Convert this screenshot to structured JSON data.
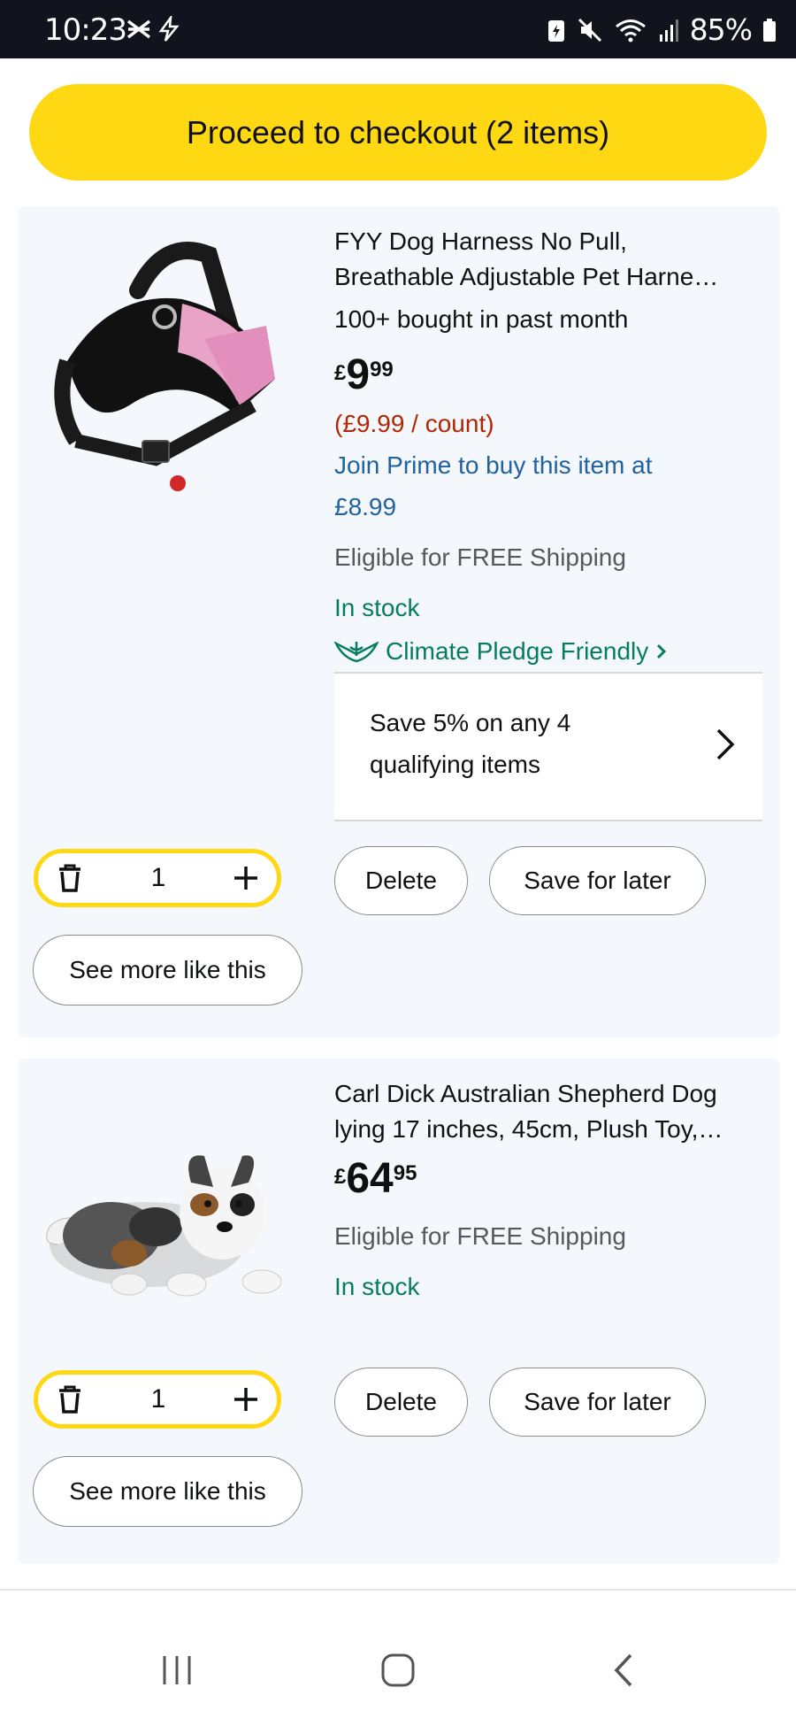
{
  "status_bar": {
    "time": "10:23",
    "battery": "85%"
  },
  "checkout": {
    "label": "Proceed to checkout (2 items)"
  },
  "items": [
    {
      "title_line1": "FYY Dog Harness No Pull,",
      "title_line2": "Breathable Adjustable Pet Harne…",
      "bought": "100+ bought in past month",
      "price_currency": "£",
      "price_whole": "9",
      "price_fraction": "99",
      "unit_price": "(£9.99 / count)",
      "prime_line1": "Join Prime to buy this item at",
      "prime_line2": "£8.99",
      "shipping": "Eligible for FREE Shipping",
      "stock": "In stock",
      "climate": "Climate Pledge Friendly",
      "promo_line1": "Save 5% on any 4",
      "promo_line2": "qualifying items",
      "quantity": "1",
      "delete_label": "Delete",
      "save_label": "Save for later",
      "more_label": "See more like this"
    },
    {
      "title_line1": "Carl Dick Australian Shepherd Dog",
      "title_line2": "lying 17 inches, 45cm, Plush Toy,…",
      "price_currency": "£",
      "price_whole": "64",
      "price_fraction": "95",
      "shipping": "Eligible for FREE Shipping",
      "stock": "In stock",
      "quantity": "1",
      "delete_label": "Delete",
      "save_label": "Save for later",
      "more_label": "See more like this"
    }
  ],
  "colors": {
    "checkout_yellow": "#ffd814",
    "price_red": "#b12704",
    "link_blue": "#2162a1",
    "stock_green": "#067d62"
  }
}
